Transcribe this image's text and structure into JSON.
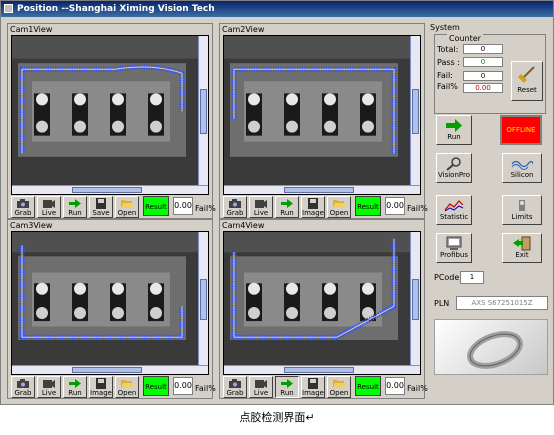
{
  "title": "Position  --Shanghai Ximing Vision Tech",
  "cams": [
    {
      "label": "Cam1View",
      "buttons": [
        "Grab",
        "Live",
        "Run",
        "Save",
        "Open"
      ],
      "result": "Result",
      "fail": "0.00",
      "fail_pct": "Fail%"
    },
    {
      "label": "Cam2View",
      "buttons": [
        "Grab",
        "Live",
        "Run",
        "Image",
        "Open"
      ],
      "result": "Result",
      "fail": "0.00",
      "fail_pct": "Fail%"
    },
    {
      "label": "Cam3View",
      "buttons": [
        "Grab",
        "Live",
        "Run",
        "Image",
        "Open"
      ],
      "result": "Result",
      "fail": "0.00",
      "fail_pct": "Fail%"
    },
    {
      "label": "Cam4View",
      "buttons": [
        "Grab",
        "Live",
        "Run",
        "Image",
        "Open"
      ],
      "result": "Result",
      "fail": "0.00",
      "fail_pct": "Fail%"
    }
  ],
  "side": {
    "system": "System",
    "counter": "Counter",
    "total_label": "Total:",
    "total": "0",
    "pass_label": "Pass :",
    "pass": "0",
    "fail_label": "Fail:",
    "fail": "0",
    "failpct_label": "Fail%",
    "failpct": "0.00",
    "reset": "Reset",
    "run": "Run",
    "offline": "OFFLINE",
    "visionpro": "VisionPro",
    "silicon": "Silicon",
    "statistic": "Statistic",
    "limits": "Limits",
    "profibus": "Profibus",
    "exit": "Exit",
    "pcode_label": "PCode",
    "pcode": "1",
    "pln_label": "PLN",
    "pln": "AXS S67251015Z"
  },
  "caption": "点胶检测界面↵",
  "colors": {
    "glue": "#3050ff",
    "titlebar": "#0a246a",
    "result": "#00ff00",
    "offline": "#ff0000"
  }
}
